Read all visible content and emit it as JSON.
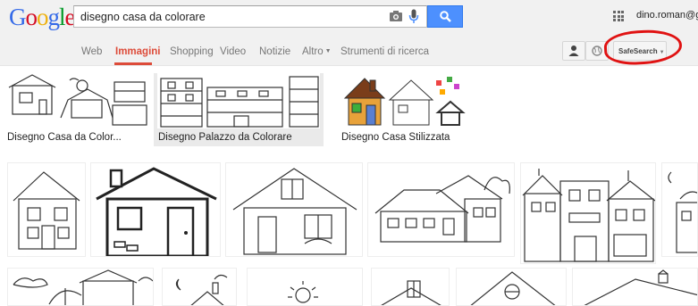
{
  "header": {
    "logo_letters": [
      "G",
      "o",
      "o",
      "g",
      "l",
      "e"
    ],
    "logo_colors": [
      "#3369e8",
      "#d50f25",
      "#eeb211",
      "#3369e8",
      "#009925",
      "#d50f25"
    ],
    "search_value": "disegno casa da colorare",
    "user": "dino.roman@gmai"
  },
  "nav": {
    "tabs": [
      "Web",
      "Immagini",
      "Shopping",
      "Video",
      "Notizie",
      "Altro",
      "Strumenti di ricerca"
    ],
    "active_tab": "Immagini",
    "safesearch": "SafeSearch"
  },
  "related": [
    {
      "label": "Disegno Casa da Color..."
    },
    {
      "label": "Disegno Palazzo da Colorare"
    },
    {
      "label": "Disegno Casa Stilizzata"
    }
  ],
  "colors": {
    "accent": "#dd4b39",
    "search_button": "#4d90fe",
    "annotation_circle": "#e01212"
  }
}
